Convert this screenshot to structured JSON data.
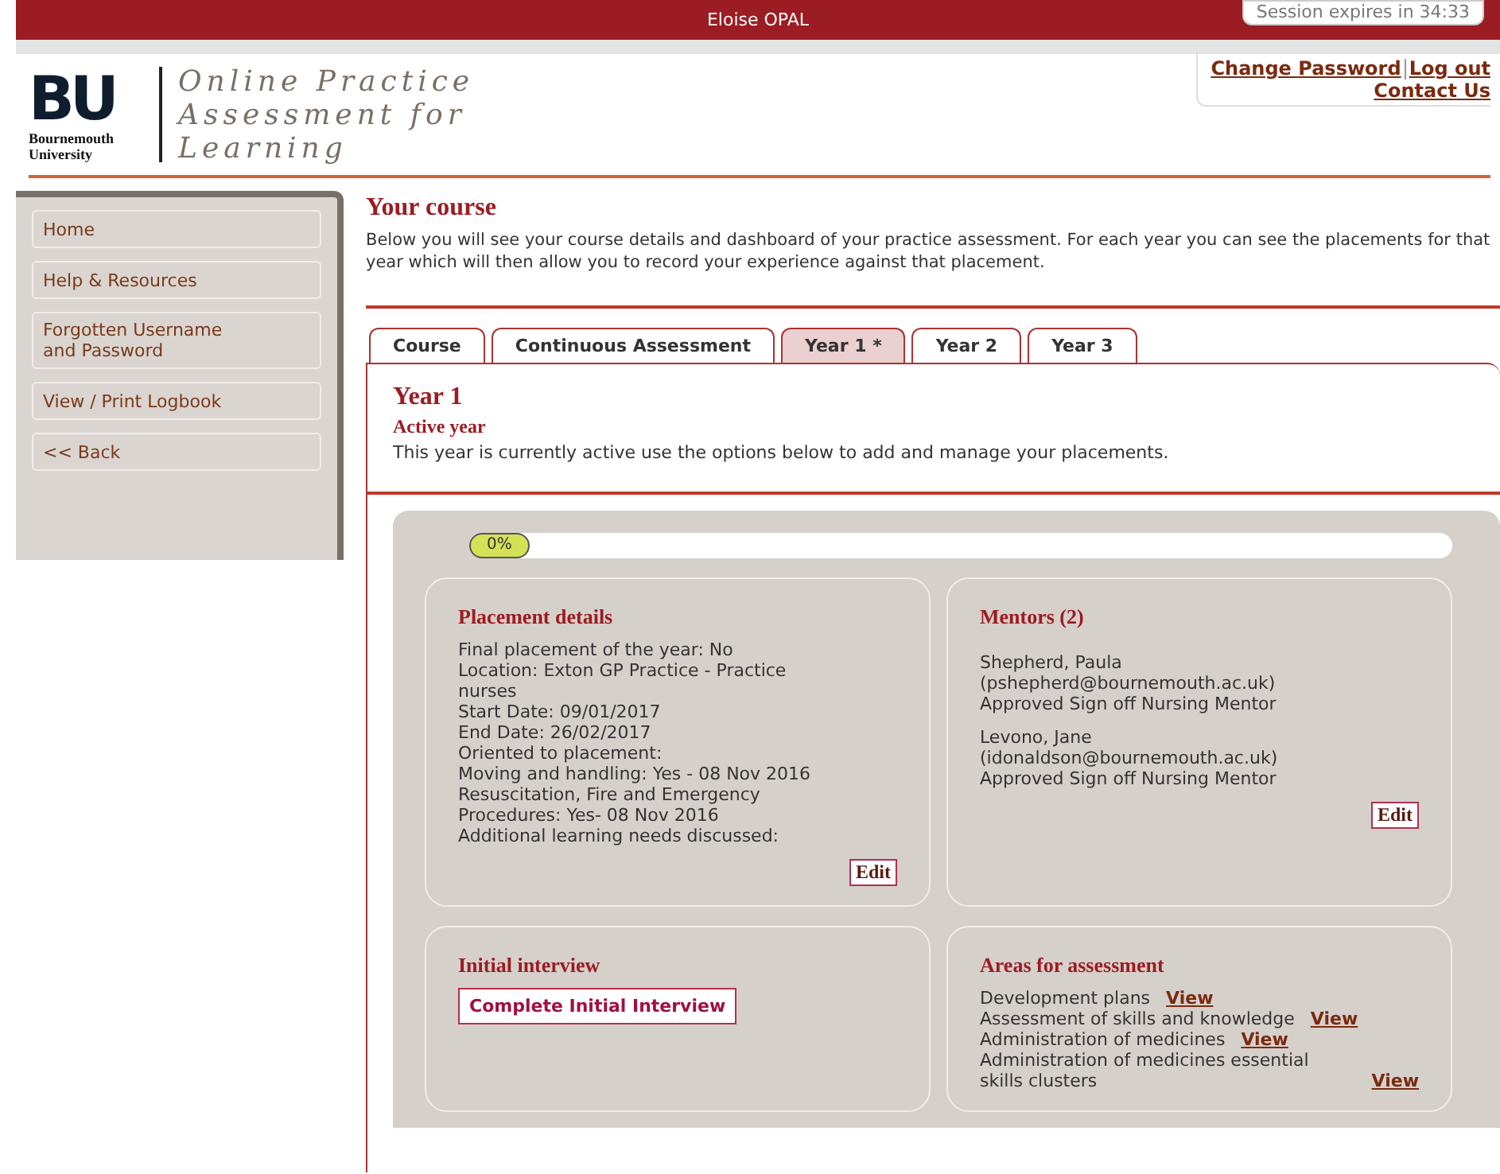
{
  "top_bar": {
    "user": "Eloise OPAL",
    "session": "Session expires in 34:33"
  },
  "header": {
    "logo_letters": "BU",
    "logo_name": "Bournemouth University",
    "title": "Online Practice Assessment for Learning",
    "links": [
      "Change Password",
      "Log out",
      "Contact Us"
    ]
  },
  "sidebar": {
    "items": [
      {
        "label": "Home"
      },
      {
        "label": "Help & Resources"
      },
      {
        "label": "Forgotten Username and Password"
      },
      {
        "label": "View / Print Logbook"
      },
      {
        "label": "<< Back"
      }
    ]
  },
  "page": {
    "title": "Your course",
    "intro": "Below you will see your course details and dashboard of your practice assessment.  For each year you can see the placements for that year which will then allow you to record your experience against that placement."
  },
  "tabs": [
    {
      "label": "Course",
      "selected": false
    },
    {
      "label": "Continuous Assessment",
      "selected": false
    },
    {
      "label": "Year 1 *",
      "selected": true
    },
    {
      "label": "Year 2",
      "selected": false
    },
    {
      "label": "Year 3",
      "selected": false
    }
  ],
  "year": {
    "title": "Year 1",
    "status": "Active year",
    "description": "This year is currently active use the options below to add and manage your placements."
  },
  "progress": {
    "level": 0,
    "reading": "0%"
  },
  "placement": {
    "title": "Placement details",
    "lines": [
      "Final placement of the year: No",
      "Location: Exton GP Practice - Practice nurses",
      "Start Date: 09/01/2017",
      "End Date: 26/02/2017",
      "Oriented to placement:",
      "Moving and handling: Yes - 08 Nov 2016",
      "Resuscitation, Fire and Emergency Procedures: Yes- 08 Nov 2016",
      "Additional learning needs discussed:"
    ],
    "button": "Edit"
  },
  "mentors": {
    "title": "Mentors (2)",
    "people": [
      {
        "name": "Shepherd, Paula",
        "email": "(pshepherd@bournemouth.ac.uk)",
        "role": "Approved Sign off Nursing Mentor"
      },
      {
        "name": "Levono, Jane",
        "email": "(idonaldson@bournemouth.ac.uk)",
        "role": "Approved Sign off Nursing Mentor"
      }
    ],
    "button": "Edit"
  },
  "interview": {
    "title": "Initial interview",
    "button": "Complete Initial Interview"
  },
  "areas": {
    "title": "Areas for assessment",
    "items": [
      {
        "label": "Development plans",
        "link": "View"
      },
      {
        "label": "Assessment of skills and knowledge",
        "link": "View"
      },
      {
        "label": "Administration of medicines",
        "link": "View"
      },
      {
        "label": "Administration of medicines essential skills clusters",
        "link": "View"
      }
    ]
  }
}
